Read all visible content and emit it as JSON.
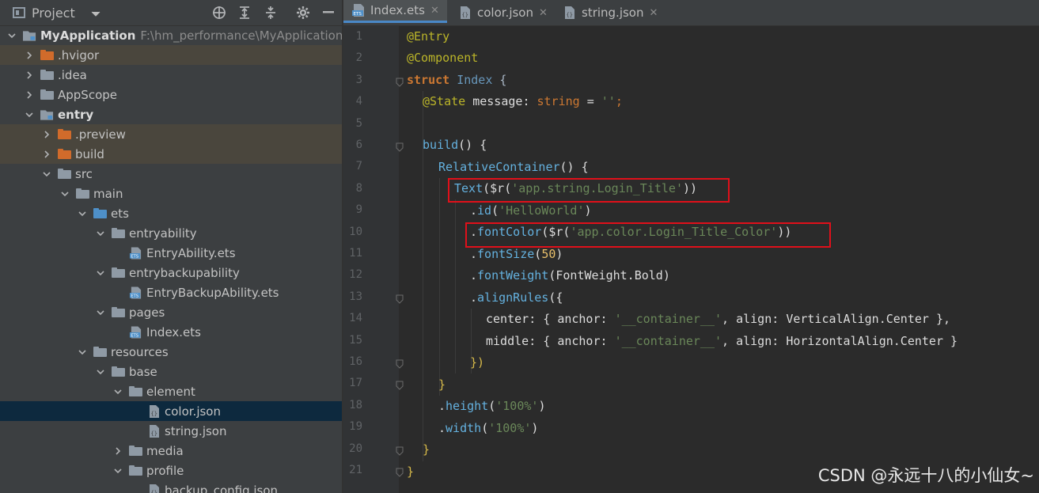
{
  "project_panel": {
    "title": "Project",
    "tree": [
      {
        "label": "MyApplication",
        "path": "F:\\hm_performance\\MyApplication",
        "bold": true
      },
      {
        "label": ".hvigor"
      },
      {
        "label": ".idea"
      },
      {
        "label": "AppScope"
      },
      {
        "label": "entry",
        "bold": true
      },
      {
        "label": ".preview"
      },
      {
        "label": "build"
      },
      {
        "label": "src"
      },
      {
        "label": "main"
      },
      {
        "label": "ets"
      },
      {
        "label": "entryability"
      },
      {
        "label": "EntryAbility.ets"
      },
      {
        "label": "entrybackupability"
      },
      {
        "label": "EntryBackupAbility.ets"
      },
      {
        "label": "pages"
      },
      {
        "label": "Index.ets"
      },
      {
        "label": "resources"
      },
      {
        "label": "base"
      },
      {
        "label": "element"
      },
      {
        "label": "color.json"
      },
      {
        "label": "string.json"
      },
      {
        "label": "media"
      },
      {
        "label": "profile"
      },
      {
        "label": "backup_config.json"
      }
    ]
  },
  "editor": {
    "tabs": [
      {
        "label": "Index.ets",
        "active": true
      },
      {
        "label": "color.json",
        "active": false
      },
      {
        "label": "string.json",
        "active": false
      }
    ],
    "line_numbers": [
      "1",
      "2",
      "3",
      "4",
      "5",
      "6",
      "7",
      "8",
      "9",
      "10",
      "11",
      "12",
      "13",
      "14",
      "15",
      "16",
      "17",
      "18",
      "19",
      "20",
      "21"
    ],
    "code": {
      "l1": "@Entry",
      "l2": "@Component",
      "l3_kw": "struct",
      "l3_name": "Index",
      "l3_brace": "{",
      "l4_anno": "@State",
      "l4_name": "message",
      "l4_colon": ":",
      "l4_type": "string",
      "l4_eq": "=",
      "l4_str": "''",
      "l4_semi": ";",
      "l6_fn": "build",
      "l6_rest": "() {",
      "l7_fn": "RelativeContainer",
      "l7_rest": "() {",
      "l8_fn": "Text",
      "l8_open": "(",
      "l8_r": "$r",
      "l8_p1": "(",
      "l8_str": "'app.string.Login_Title'",
      "l8_close": "))",
      "l9_dot": ".",
      "l9_fn": "id",
      "l9_p1": "(",
      "l9_str": "'HelloWorld'",
      "l9_p2": ")",
      "l10_dot": ".",
      "l10_fn": "fontColor",
      "l10_p1": "(",
      "l10_r": "$r",
      "l10_p2": "(",
      "l10_str": "'app.color.Login_Title_Color'",
      "l10_close": "))",
      "l11_dot": ".",
      "l11_fn": "fontSize",
      "l11_p1": "(",
      "l11_num": "50",
      "l11_p2": ")",
      "l12_dot": ".",
      "l12_fn": "fontWeight",
      "l12_p1": "(",
      "l12_arg": "FontWeight.Bold",
      "l12_p2": ")",
      "l13_dot": ".",
      "l13_fn": "alignRules",
      "l13_rest": "({",
      "l14_k1": "center",
      "l14_a": ": { ",
      "l14_k2": "anchor",
      "l14_b": ": ",
      "l14_str": "'__container__'",
      "l14_c": ", ",
      "l14_k3": "align",
      "l14_d": ": ",
      "l14_v": "VerticalAlign.Center",
      "l14_e": " },",
      "l15_k1": "middle",
      "l15_a": ": { ",
      "l15_k2": "anchor",
      "l15_b": ": ",
      "l15_str": "'__container__'",
      "l15_c": ", ",
      "l15_k3": "align",
      "l15_d": ": ",
      "l15_v": "HorizontalAlign.Center",
      "l15_e": " }",
      "l16": "})",
      "l17": "}",
      "l18_dot": ".",
      "l18_fn": "height",
      "l18_p1": "(",
      "l18_str": "'100%'",
      "l18_p2": ")",
      "l19_dot": ".",
      "l19_fn": "width",
      "l19_p1": "(",
      "l19_str": "'100%'",
      "l19_p2": ")",
      "l20": "}",
      "l21": "}"
    }
  },
  "watermark": "CSDN @永远十八的小仙女~",
  "colors": {
    "highlight_border": "#e0101a",
    "active_tab_underline": "#4a88c7"
  }
}
